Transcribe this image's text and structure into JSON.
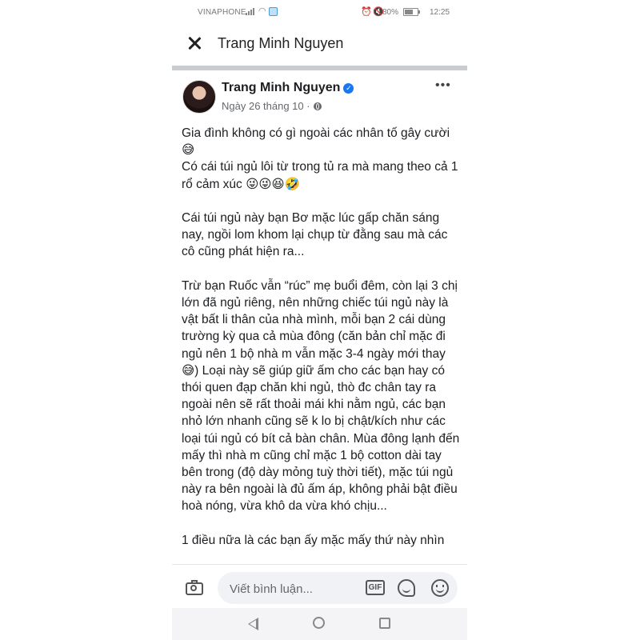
{
  "status_bar": {
    "carrier": "VINAPHONE",
    "battery": "80%",
    "time": "12:25"
  },
  "header": {
    "title": "Trang Minh Nguyen"
  },
  "post": {
    "author": "Trang Minh Nguyen",
    "verified_mark": "✓",
    "date": "Ngày 26 tháng 10 ·",
    "more_label": "•••",
    "paragraphs": [
      "Gia đình không có gì ngoài các nhân tố gây cười 😅\nCó cái túi ngủ lôi từ trong tủ ra mà mang theo cả 1 rổ cảm xúc 😜😜😆🤣",
      "Cái túi ngủ này bạn Bơ mặc lúc gấp chăn sáng nay, ngồi lom khom lại chụp từ đằng sau mà các cô cũng phát hiện ra...",
      "Trừ bạn Ruốc vẫn “rúc” mẹ buổi đêm, còn lại 3 chị lớn đã ngủ riêng, nên những chiếc túi ngủ này là vật bất li thân của nhà mình, mỗi bạn 2 cái dùng trường kỳ qua cả mùa đông (căn bản chỉ mặc đi ngủ nên 1 bộ nhà m vẫn mặc 3-4 ngày mới thay 😅) Loại này sẽ giúp giữ ấm cho các bạn hay có thói quen đạp chăn khi ngủ, thò đc chân tay ra ngoài nên sẽ rất thoải mái khi nằm ngủ, các bạn nhỏ lớn nhanh cũng sẽ k lo bị chật/kích như các loại túi ngủ có bít cả bàn chân. Mùa đông lạnh đến mấy thì nhà m cũng chỉ mặc 1 bộ cotton dài tay bên trong (độ dày mỏng tuỳ thời tiết), mặc túi ngủ này ra bên ngoài là đủ ấm áp, không phải bật điều hoà nóng, vừa khô da vừa khó chịu...",
      "1 điều nữa là các bạn ấy mặc mấy thứ này nhìn"
    ]
  },
  "comment_bar": {
    "placeholder": "Viết bình luận...",
    "gif_label": "GIF"
  },
  "icons": {
    "close": "close-icon",
    "camera": "camera-icon",
    "gif": "gif-icon",
    "sticker": "sticker-icon",
    "emoji": "emoji-icon",
    "back": "back-icon",
    "home": "home-icon",
    "recent": "recent-apps-icon"
  },
  "colors": {
    "verified": "#1877f2",
    "divider": "#c9ccd1",
    "comment_input_bg": "#f0f2f5"
  }
}
